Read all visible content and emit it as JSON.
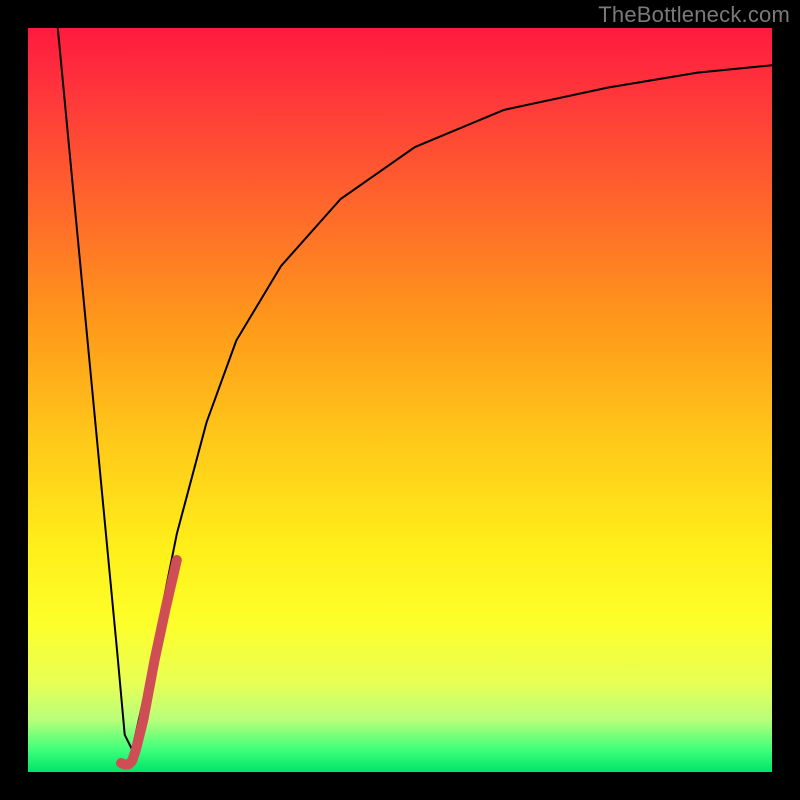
{
  "watermark": {
    "text": "TheBottleneck.com"
  },
  "axes": {
    "x_range": [
      0,
      100
    ],
    "y_range": [
      0,
      100
    ],
    "grid": false
  },
  "chart_data": {
    "type": "line",
    "title": "",
    "xlabel": "",
    "ylabel": "",
    "xlim": [
      0,
      100
    ],
    "ylim": [
      0,
      100
    ],
    "series": [
      {
        "name": "black-curve",
        "stroke": "#000000",
        "stroke_width": 2,
        "x": [
          4,
          6,
          8,
          10,
          12,
          13,
          14,
          16,
          18,
          20,
          24,
          28,
          34,
          42,
          52,
          64,
          78,
          90,
          100
        ],
        "y": [
          100,
          79,
          58,
          37,
          16,
          5,
          3,
          12,
          22,
          32,
          47,
          58,
          68,
          77,
          84,
          89,
          92,
          94,
          95
        ]
      },
      {
        "name": "red-segment",
        "stroke": "#cf4e55",
        "stroke_width": 10,
        "linecap": "round",
        "x": [
          12.5,
          13.0,
          13.5,
          14.0,
          14.5,
          15.5,
          17.0,
          18.5,
          20.0
        ],
        "y": [
          1.2,
          1.0,
          1.0,
          1.5,
          3.0,
          7.0,
          15.0,
          22.0,
          28.5
        ]
      }
    ]
  }
}
